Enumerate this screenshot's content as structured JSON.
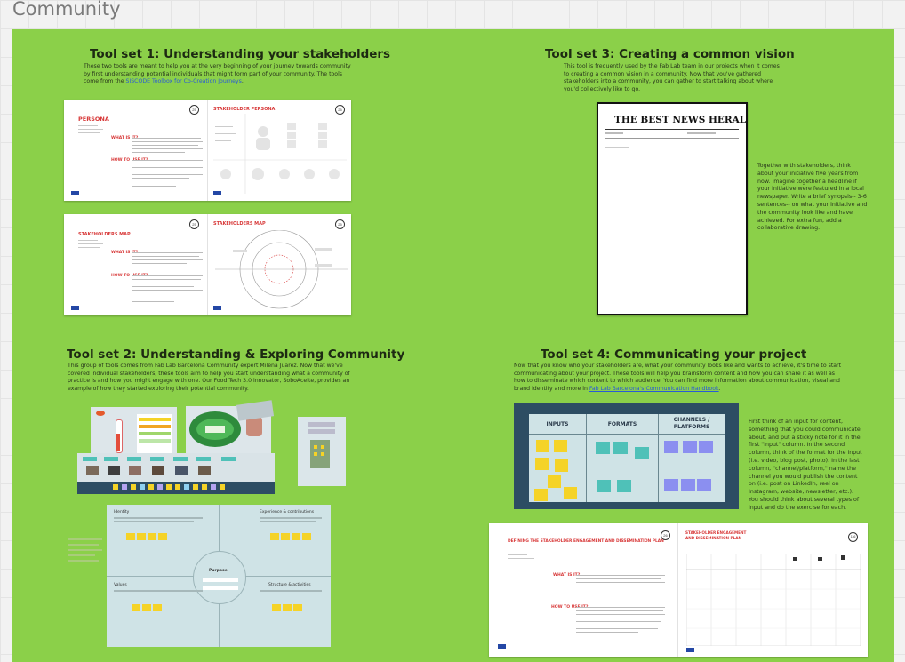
{
  "frame": {
    "title": "Community"
  },
  "toolset1": {
    "title": "Tool set 1: Understanding your stakeholders",
    "desc_before": "These two tools are meant to help you at the very beginning of your journey towards community by first understanding potential individuals that might form part of your community. The tools come from the ",
    "link": "SISCODE Toolbox for Co-Creation Journeys",
    "desc_after": ".",
    "card1": {
      "left_title": "PERSONA",
      "what_label": "WHAT IS IT?",
      "how_label": "HOW TO USE IT?",
      "right_title": "STAKEHOLDER PERSONA"
    },
    "card2": {
      "left_title": "STAKEHOLDERS MAP",
      "what_label": "WHAT IS IT?",
      "how_label": "HOW TO USE IT?",
      "right_title": "STAKEHOLDERS MAP"
    },
    "badge": "25"
  },
  "toolset2": {
    "title": "Tool set 2: Understanding & Exploring Community",
    "desc": "This group of tools comes from Fab Lab Barcelona Community expert Milena Juarez. Now that we've covered individual stakeholders, these tools aim to help you start understanding what a community of practice is and how you might engage with one. Our Food Tech 3.0 innovator, SoboAceite, provides an example of how they started exploring their potential community.",
    "canvas": {
      "identity": "Identity",
      "experience": "Experience & contributions",
      "values": "Values",
      "structure": "Structure & activities",
      "purpose": "Purpose"
    }
  },
  "toolset3": {
    "title": "Tool set 3: Creating a common vision",
    "desc": "This tool is frequently used by the Fab Lab team in our projects when it comes to creating a common vision in a community. Now that you've gathered stakeholders into a community, you can gather to start talking about where you'd collectively like to go.",
    "paper_title": "THE BEST NEWS HERALD",
    "side_text": "Together with stakeholders, think about your initiative five years from now. Imagine together a headline if your initiative were featured in a local newspaper. Write a brief synopsis-- 3-6 sentences-- on what your initiative and the community look like and have achieved. For extra fun, add a collaborative drawing."
  },
  "toolset4": {
    "title": "Tool set 4: Communicating your project",
    "desc_before": "Now that you know who your stakeholders are, what your community looks like and wants to achieve, it's time to start communicating about your project. These tools will help you brainstorm content and how you can share it as well as how to disseminate which content to which audience. You can find more information about communication, visual and brand identity and more in ",
    "link": "Fab Lab Barcelona's Communication Handbook",
    "desc_after": ".",
    "columns": [
      "INPUTS",
      "FORMATS",
      "CHANNELS / PLATFORMS"
    ],
    "side_text": "First think of an input for content, something that you could communicate about, and put a sticky note for it in the first \"input\" column. In the second column, think of the format for the input (i.e. video, blog post, photo). In the last column, \"channel/platform,\" name the channel you would publish the content on (i.e. post on LinkedIn, reel on Instagram, website, newsletter, etc.). You should think about several types of input and do the exercise for each.",
    "plan_left_title": "DEFINING THE STAKEHOLDER ENGAGEMENT AND DISSEMINATION PLAN",
    "plan_right_title": "STAKEHOLDER ENGAGEMENT AND DISSEMINATION PLAN",
    "what_label": "WHAT IS IT?",
    "how_label": "HOW TO USE IT?",
    "badge": "26",
    "badge2": "136"
  },
  "colors": {
    "board": "#8bd049",
    "sticky_yellow": "#f5d327",
    "sticky_teal": "#4fc1b8",
    "sticky_violet": "#8b8ff0",
    "red_heading": "#d83a3a",
    "navy_frame": "#2d4d63"
  }
}
